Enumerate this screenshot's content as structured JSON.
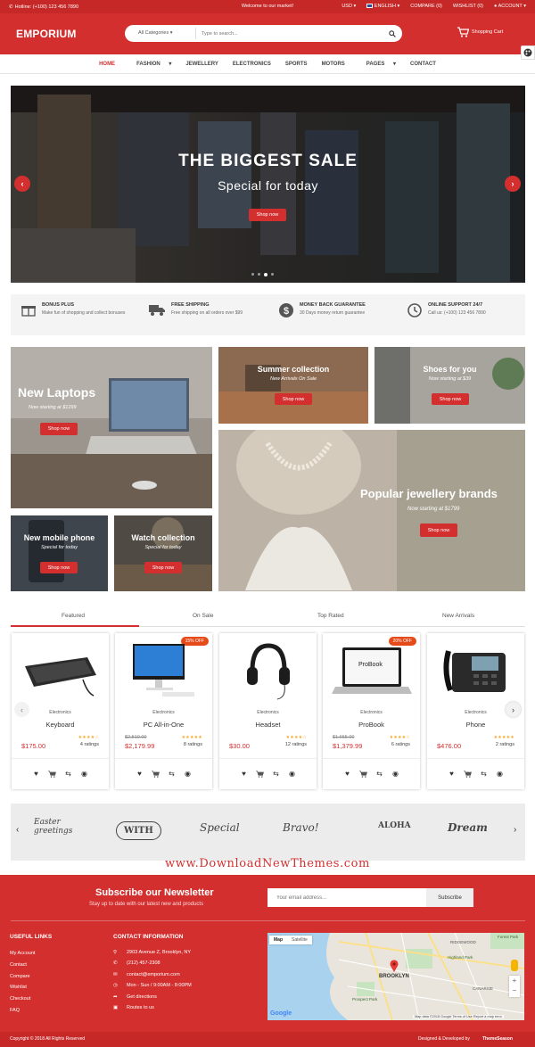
{
  "topbar": {
    "hotline": "Hotline: (+100) 123 456 7890",
    "welcome": "Welcome to our market!",
    "currency": "USD",
    "language": "ENGLISH",
    "compare": "COMPARE (0)",
    "wishlist": "WISHLIST (0)",
    "account": "ACCOUNT"
  },
  "header": {
    "logo": "EMPORIUM",
    "category_select": "All Categories",
    "search_placeholder": "Type to search...",
    "cart_label": "Shopping Cart"
  },
  "nav": [
    "HOME",
    "FASHION",
    "JEWELLERY",
    "ELECTRONICS",
    "SPORTS",
    "MOTORS",
    "PAGES",
    "CONTACT"
  ],
  "hero": {
    "title": "THE BIGGEST SALE",
    "subtitle": "Special for today",
    "button": "Shop now",
    "slides": 4,
    "active_slide": 2
  },
  "features": [
    {
      "title": "BONUS PLUS",
      "desc": "Make fun of shopping and collect bonuses",
      "icon": "gift-icon"
    },
    {
      "title": "FREE SHIPPING",
      "desc": "Free shipping on all orders over $99",
      "icon": "truck-icon"
    },
    {
      "title": "MONEY BACK GUARANTEE",
      "desc": "30 Days money return guarantee",
      "icon": "dollar-icon"
    },
    {
      "title": "ONLINE SUPPORT 24/7",
      "desc": "Call us: (+100) 123 456 7890",
      "icon": "clock-icon"
    }
  ],
  "banners": {
    "laptops": {
      "title": "New Laptops",
      "sub": "Now starting at $1299",
      "button": "Shop now"
    },
    "summer": {
      "title": "Summer collection",
      "sub": "New Arrivals On Sale",
      "button": "Shop now"
    },
    "shoes": {
      "title": "Shoes for you",
      "sub": "Now starting at $39",
      "button": "Shop now"
    },
    "jewellery": {
      "title": "Popular jewellery brands",
      "sub": "Now starting at $1799",
      "button": "Shop now"
    },
    "phone": {
      "title": "New mobile phone",
      "sub": "Special for today",
      "button": "Shop now"
    },
    "watch": {
      "title": "Watch collection",
      "sub": "Special for today",
      "button": "Shop now"
    }
  },
  "tabs": [
    "Featured",
    "On Sale",
    "Top Rated",
    "New Arrivals"
  ],
  "products": [
    {
      "category": "Electronics",
      "name": "Keyboard",
      "old_price": "",
      "price": "$175.00",
      "rating": 4,
      "ratings": "4 ratings",
      "badge": ""
    },
    {
      "category": "Electronics",
      "name": "PC All-in-One",
      "old_price": "$2,510.00",
      "price": "$2,179.99",
      "rating": 5,
      "ratings": "8 ratings",
      "badge": "15% OFF"
    },
    {
      "category": "Electronics",
      "name": "Headset",
      "old_price": "",
      "price": "$30.00",
      "rating": 4,
      "ratings": "12 ratings",
      "badge": ""
    },
    {
      "category": "Electronics",
      "name": "ProBook",
      "old_price": "$1,655.00",
      "price": "$1,379.99",
      "rating": 4,
      "ratings": "6 ratings",
      "badge": "20% OFF"
    },
    {
      "category": "Electronics",
      "name": "Phone",
      "old_price": "",
      "price": "$476.00",
      "rating": 5,
      "ratings": "2 ratings",
      "badge": ""
    }
  ],
  "probook_screen": "ProBook",
  "brands": [
    "Easter greetings",
    "WITH",
    "Special",
    "Bravo!",
    "ALOHA",
    "Dream"
  ],
  "watermark": "www.DownloadNewThemes.com",
  "newsletter": {
    "title": "Subscribe our Newsletter",
    "sub": "Stay up to date with our latest new and products",
    "placeholder": "Your email address...",
    "button": "Subscribe"
  },
  "useful_links": {
    "heading": "USEFUL LINKS",
    "items": [
      "My Account",
      "Contact",
      "Compare",
      "Wishlist",
      "Checkout",
      "FAQ"
    ]
  },
  "contact": {
    "heading": "CONTACT INFORMATION",
    "items": [
      {
        "icon": "map-pin-icon",
        "text": "2903 Avenue Z, Brooklyn, NY"
      },
      {
        "icon": "phone-icon",
        "text": "(212) 457-2308"
      },
      {
        "icon": "mail-icon",
        "text": "contact@emporium.com"
      },
      {
        "icon": "clock-icon",
        "text": "Mon - Sun / 9:00AM - 8:00PM"
      },
      {
        "icon": "directions-icon",
        "text": "Get directions"
      },
      {
        "icon": "bus-icon",
        "text": "Routes to us"
      }
    ]
  },
  "map": {
    "tab_map": "Map",
    "tab_satellite": "Satellite",
    "label_brooklyn": "BROOKLYN",
    "label_forest_park": "Forest Park",
    "label_highland_park": "Highland Park",
    "label_ridgewood": "RIDGEWOOD",
    "label_prospect_park": "Prospect Park",
    "label_canarsie": "CANARSIE",
    "google": "Google",
    "footer_text": "Map data ©2018 Google   Terms of Use   Report a map error"
  },
  "footer": {
    "copyright": "Copyright © 2018 All Rights Reserved",
    "designed": "Designed & Developed by",
    "designer": "ThemeSeason"
  }
}
